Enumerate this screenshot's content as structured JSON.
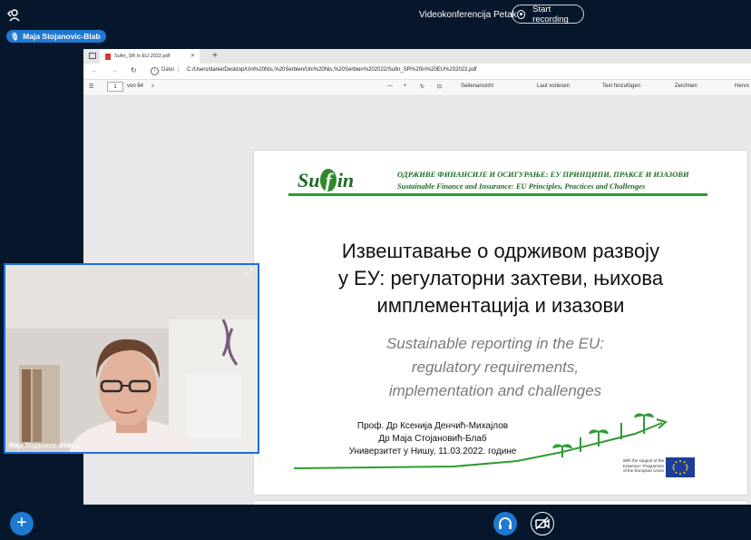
{
  "topbar": {
    "meeting_title": "Videokonferencija Petak",
    "record_label": "Start recording",
    "presenter": "Maja Stojanovic-Blab"
  },
  "browser": {
    "tab_title": "Sufin_SR in EU 2022.pdf",
    "datei_label": "Datei",
    "url": "C:/Users/danie/Desktop/Uni%20Nis,%20Serbien/Uni%20Nis,%20Serbien%202022/Sufin_SR%20in%20EU%202022.pdf",
    "page_current": "1",
    "page_total": "von 64",
    "tools": {
      "seitenansicht": "Seitenansicht",
      "laut_vorlesen": "Laut vorlesen",
      "text_hinzufuegen": "Text hinzufügen",
      "zeichnen": "Zeichnen",
      "hervor": "Hervo"
    }
  },
  "slide": {
    "logo": "Sufin",
    "header_sr": "ОДРЖИВЕ ФИНАНСИЈЕ И ОСИГУРАЊЕ: ЕУ ПРИНЦИПИ, ПРАКСЕ И ИЗАЗОВИ",
    "header_en": "Sustainable Finance and Insurance: EU Principles, Practices and Challenges",
    "title_sr_1": "Извештавање о одрживом развоју",
    "title_sr_2": "у ЕУ: регулаторни захтеви, њихова",
    "title_sr_3": "имплементација и изазови",
    "title_en_1": "Sustainable reporting in the EU:",
    "title_en_2": "regulatory requirements,",
    "title_en_3": "implementation and challenges",
    "author_1": "Проф. Др Ксенија Денчић-Михајлов",
    "author_2": "Др Маја Стојановић-Блаб",
    "author_3": "Универзитет у Нишу, 11.03.2022. године",
    "eu_support_1": "With the support of the",
    "eu_support_2": "Erasmus+ Programme",
    "eu_support_3": "of the European Union"
  },
  "camera": {
    "participant_name": "Maja Stojanovic-Blab ⌄"
  },
  "bottombar": {
    "plus": "+"
  }
}
